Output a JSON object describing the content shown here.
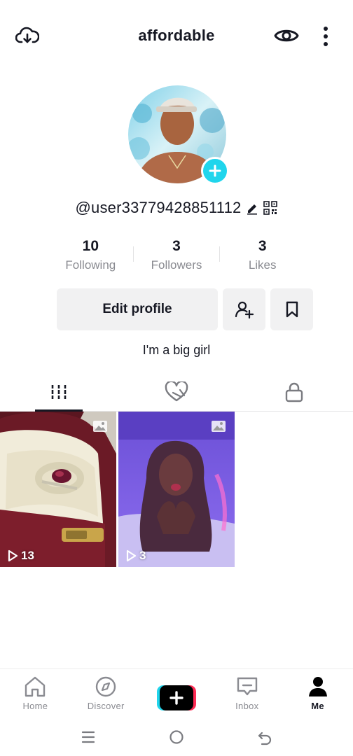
{
  "header": {
    "title": "affordable"
  },
  "profile": {
    "username": "@user33779428851112",
    "bio": "I'm a big girl"
  },
  "stats": [
    {
      "value": "10",
      "label": "Following"
    },
    {
      "value": "3",
      "label": "Followers"
    },
    {
      "value": "3",
      "label": "Likes"
    }
  ],
  "actions": {
    "edit_label": "Edit profile"
  },
  "tabs": [
    {
      "icon": "videos-grid-icon",
      "active": true
    },
    {
      "icon": "liked-heart-icon",
      "active": false
    },
    {
      "icon": "lock-icon",
      "active": false
    }
  ],
  "videos": [
    {
      "plays": "13",
      "type": "photo"
    },
    {
      "plays": "3",
      "type": "photo"
    }
  ],
  "bottom_nav": [
    {
      "label": "Home",
      "icon": "home-icon"
    },
    {
      "label": "Discover",
      "icon": "compass-icon"
    },
    {
      "label": "",
      "icon": "create-plus-icon"
    },
    {
      "label": "Inbox",
      "icon": "inbox-icon"
    },
    {
      "label": "Me",
      "icon": "person-icon",
      "active": true
    }
  ],
  "colors": {
    "accent_cyan": "#20d5ec",
    "accent_red": "#fe2c55",
    "text": "#161823",
    "muted": "#8a8b91"
  }
}
